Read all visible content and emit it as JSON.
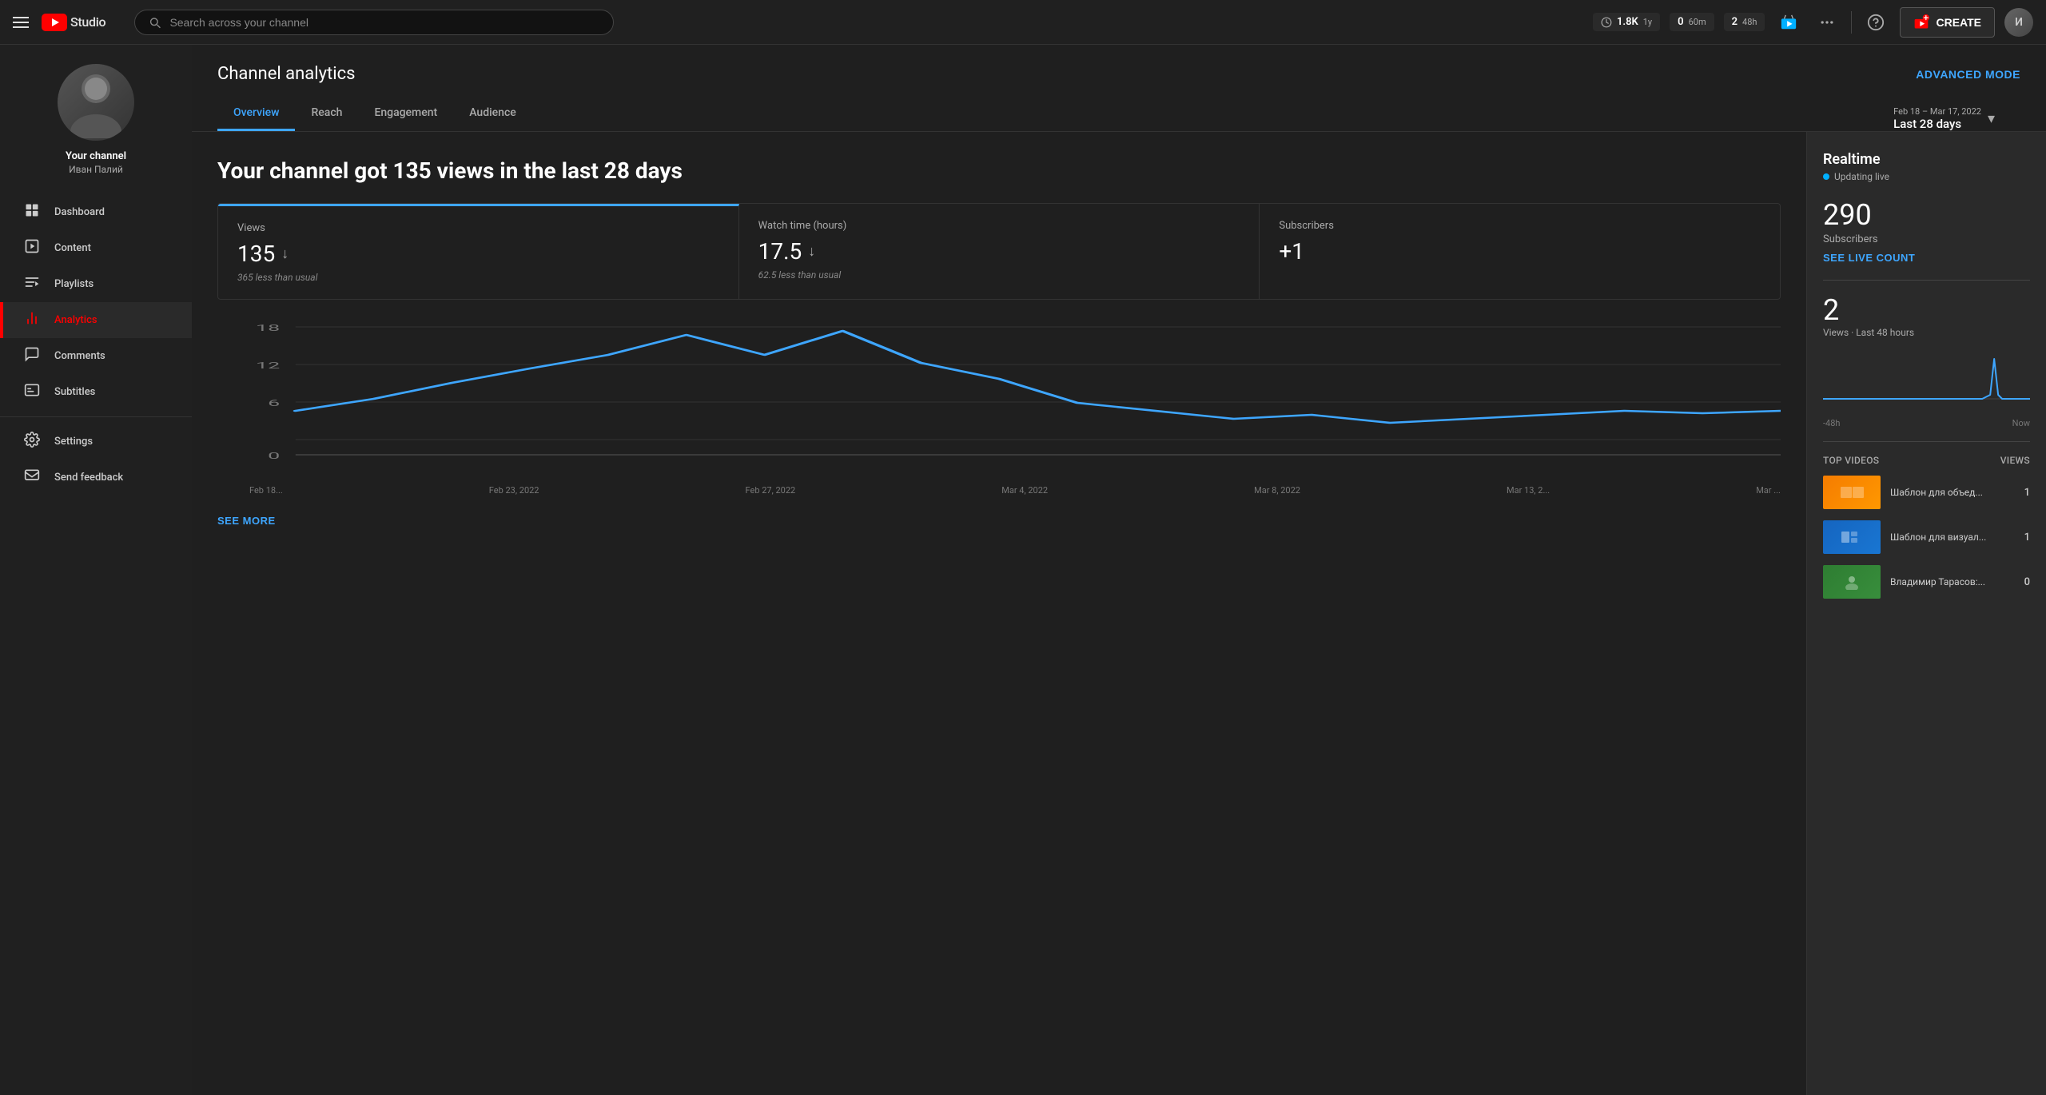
{
  "topbar": {
    "search_placeholder": "Search across your channel",
    "stats": [
      {
        "num": "1.8K",
        "label": "1y",
        "icon": "clock"
      },
      {
        "num": "0",
        "label": "60m"
      },
      {
        "num": "2",
        "label": "48h"
      }
    ],
    "create_label": "CREATE",
    "help_tooltip": "Help"
  },
  "sidebar": {
    "channel_name": "Your channel",
    "channel_handle": "Иван Палий",
    "nav_items": [
      {
        "id": "dashboard",
        "label": "Dashboard",
        "icon": "⊞"
      },
      {
        "id": "content",
        "label": "Content",
        "icon": "▶"
      },
      {
        "id": "playlists",
        "label": "Playlists",
        "icon": "☰"
      },
      {
        "id": "analytics",
        "label": "Analytics",
        "icon": "📊",
        "active": true
      },
      {
        "id": "comments",
        "label": "Comments",
        "icon": "💬"
      },
      {
        "id": "subtitles",
        "label": "Subtitles",
        "icon": "⊟"
      },
      {
        "id": "settings",
        "label": "Settings",
        "icon": "⚙"
      },
      {
        "id": "feedback",
        "label": "Send feedback",
        "icon": "✉"
      }
    ]
  },
  "analytics": {
    "page_title": "Channel analytics",
    "advanced_mode_label": "ADVANCED MODE",
    "tabs": [
      {
        "id": "overview",
        "label": "Overview",
        "active": true
      },
      {
        "id": "reach",
        "label": "Reach",
        "active": false
      },
      {
        "id": "engagement",
        "label": "Engagement",
        "active": false
      },
      {
        "id": "audience",
        "label": "Audience",
        "active": false
      }
    ],
    "date_range": {
      "label": "Feb 18 – Mar 17, 2022",
      "period": "Last 28 days"
    },
    "headline": "Your channel got 135 views in the last 28 days",
    "stats": [
      {
        "label": "Views",
        "value": "135",
        "trend": "down",
        "sub": "365 less than usual"
      },
      {
        "label": "Watch time (hours)",
        "value": "17.5",
        "trend": "down",
        "sub": "62.5 less than usual"
      },
      {
        "label": "Subscribers",
        "value": "+1",
        "trend": "none",
        "sub": ""
      }
    ],
    "chart": {
      "x_labels": [
        "Feb 18...",
        "Feb 23, 2022",
        "Feb 27, 2022",
        "Mar 4, 2022",
        "Mar 8, 2022",
        "Mar 13, 2...",
        "Mar ..."
      ],
      "y_labels": [
        "0",
        "6",
        "12",
        "18"
      ]
    },
    "see_more_label": "SEE MORE"
  },
  "realtime": {
    "title": "Realtime",
    "live_label": "Updating live",
    "subscribers_count": "290",
    "subscribers_label": "Subscribers",
    "see_live_label": "SEE LIVE COUNT",
    "views_count": "2",
    "views_label": "Views · Last 48 hours",
    "chart_labels": {
      "start": "-48h",
      "end": "Now"
    },
    "top_videos_label": "Top videos",
    "views_col_label": "Views",
    "videos": [
      {
        "title": "Шаблон для объед...",
        "views": "1",
        "thumb_class": "video-thumb-orange"
      },
      {
        "title": "Шаблон для визуал...",
        "views": "1",
        "thumb_class": "video-thumb-blue"
      },
      {
        "title": "Владимир Тарасов:...",
        "views": "0",
        "thumb_class": "video-thumb-person"
      }
    ]
  }
}
